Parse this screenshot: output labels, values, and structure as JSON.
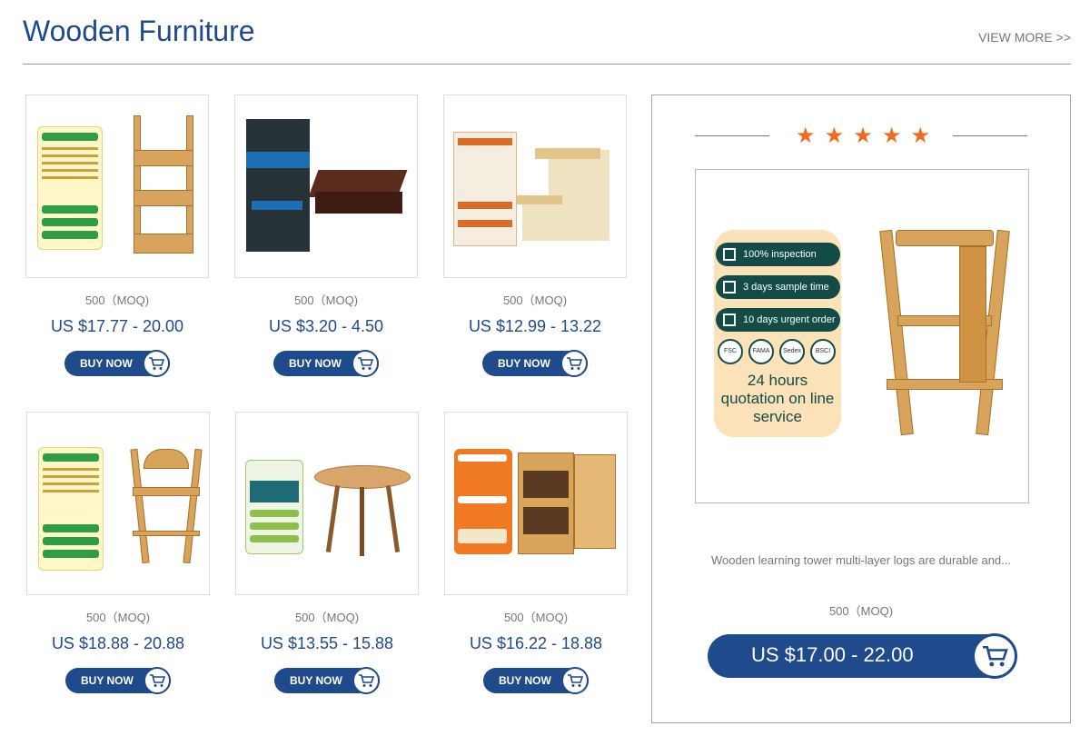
{
  "header": {
    "title": "Wooden Furniture",
    "view_more": "VIEW MORE >>"
  },
  "products": [
    {
      "moq": "500（MOQ)",
      "price": "US $17.77 - 20.00",
      "buy": "BUY NOW",
      "image": "bamboo bath shelf"
    },
    {
      "moq": "500（MOQ)",
      "price": "US $3.20 - 4.50",
      "buy": "BUY NOW",
      "image": "wooden foot rest"
    },
    {
      "moq": "500（MOQ)",
      "price": "US $12.99 - 13.22",
      "buy": "BUY NOW",
      "image": "two step stool"
    },
    {
      "moq": "500（MOQ)",
      "price": "US $18.88 - 20.88",
      "buy": "BUY NOW",
      "image": "wooden high chair"
    },
    {
      "moq": "500（MOQ)",
      "price": "US $13.55 - 15.88",
      "buy": "BUY NOW",
      "image": "round coffee table"
    },
    {
      "moq": "500（MOQ)",
      "price": "US $16.22 - 18.88",
      "buy": "BUY NOW",
      "image": "bamboo storage cabinet"
    }
  ],
  "featured": {
    "stars": [
      "★",
      "★",
      "★",
      "★",
      "★"
    ],
    "rating_stars": 5,
    "badges": [
      "100% inspection",
      "3 days sample time",
      "10 days urgent order"
    ],
    "logos": [
      "FSC",
      "FAMA",
      "Sedex",
      "BSCI"
    ],
    "quote": "24 hours quotation on line service",
    "description": "Wooden learning tower multi-layer logs are durable and...",
    "moq": "500（MOQ)",
    "price": "US $17.00 - 22.00"
  },
  "colors": {
    "brand": "#1f4a8c",
    "star": "#f26b1d",
    "badge_dark": "#134b47"
  },
  "icons": {
    "cart": "cart-icon",
    "star": "star-icon",
    "check": "checkbox-icon"
  }
}
